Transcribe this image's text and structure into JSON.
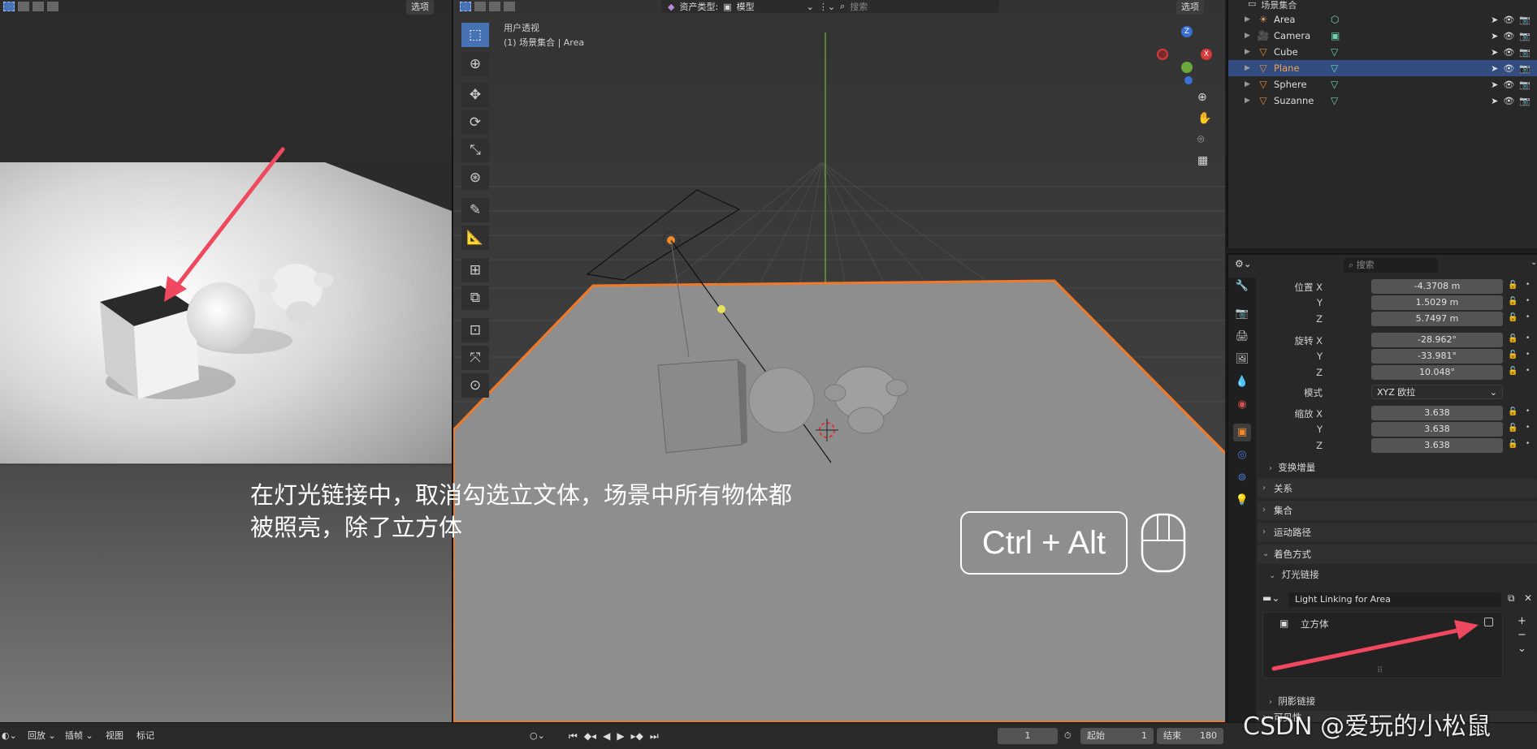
{
  "render_view": {
    "header_btn": "选项"
  },
  "viewport": {
    "header": {
      "asset_type": "资产类型:",
      "mode": "模型",
      "search_placeholder": "搜索",
      "options": "选项"
    },
    "overlay_line1": "用户透视",
    "overlay_line2": "(1) 场景集合 | Area",
    "axis_labels": {
      "z": "Z",
      "x": "X"
    }
  },
  "annotation": {
    "caption_line1": "在灯光链接中，取消勾选立文体，场景中所有物体都",
    "caption_line2": "被照亮，除了立方体",
    "shortcut": "Ctrl + Alt"
  },
  "outliner": {
    "collection": "场景集合",
    "items": [
      {
        "name": "Area",
        "icon": "light-icon",
        "color": "#e0a060",
        "selected": false
      },
      {
        "name": "Camera",
        "icon": "camera-icon",
        "color": "#e0a060",
        "selected": false
      },
      {
        "name": "Cube",
        "icon": "mesh-icon",
        "color": "#e08a3c",
        "selected": false
      },
      {
        "name": "Plane",
        "icon": "mesh-icon",
        "color": "#e08a3c",
        "selected": true
      },
      {
        "name": "Sphere",
        "icon": "mesh-icon",
        "color": "#e08a3c",
        "selected": false
      },
      {
        "name": "Suzanne",
        "icon": "mesh-icon",
        "color": "#e08a3c",
        "selected": false
      }
    ]
  },
  "properties": {
    "search_placeholder": "搜索",
    "location": {
      "label": "位置",
      "x": "-4.3708 m",
      "y": "1.5029 m",
      "z": "5.7497 m"
    },
    "rotation": {
      "label": "旋转",
      "x": "-28.962°",
      "y": "-33.981°",
      "z": "10.048°"
    },
    "mode": {
      "label": "模式",
      "value": "XYZ 欧拉"
    },
    "scale": {
      "label": "缩放",
      "x": "3.638",
      "y": "3.638",
      "z": "3.638"
    },
    "axis": {
      "x": "X",
      "y": "Y",
      "z": "Z"
    },
    "panels": {
      "delta": "变换增量",
      "relations": "关系",
      "collections": "集合",
      "motion_paths": "运动路径",
      "shading": "着色方式",
      "light_linking": "灯光链接",
      "shadow_linking": "阴影链接",
      "visibility": "可见性"
    },
    "light_linking_collection": "Light Linking for Area",
    "link_item": "立方体"
  },
  "timeline": {
    "playback": "回放",
    "keying": "插帧",
    "view": "视图",
    "marker": "标记",
    "current_frame": "1",
    "start_label": "起始",
    "start": "1",
    "end_label": "结束",
    "end": "180"
  },
  "watermark": "CSDN @爱玩的小松鼠"
}
